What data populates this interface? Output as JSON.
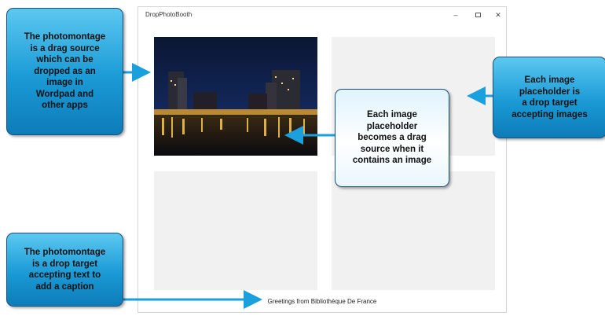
{
  "window": {
    "title": "DropPhotoBooth",
    "minimize_glyph": "–",
    "close_glyph": "✕"
  },
  "placeholders": [
    {
      "name": "top-left",
      "has_image": true
    },
    {
      "name": "top-right",
      "has_image": false
    },
    {
      "name": "bottom-left",
      "has_image": false
    },
    {
      "name": "bottom-right",
      "has_image": false
    }
  ],
  "caption": "Greetings from Bibliothèque De France",
  "callouts": {
    "photomontage_drag_source": "The photomontage\nis a drag source\nwhich can be\ndropped as an\nimage in\nWordpad and\nother apps",
    "placeholder_drag_source": "Each image\nplaceholder\nbecomes a drag\nsource when it\ncontains an image",
    "placeholder_drop_target": "Each image\nplaceholder is\na drop target\naccepting images",
    "photomontage_drop_target": "The photomontage\nis a drop target\naccepting text to\nadd a caption"
  },
  "colors": {
    "callout_blue": "#1a9ad6",
    "arrow": "#1aa0dc",
    "placeholder": "#f1f1f1"
  }
}
